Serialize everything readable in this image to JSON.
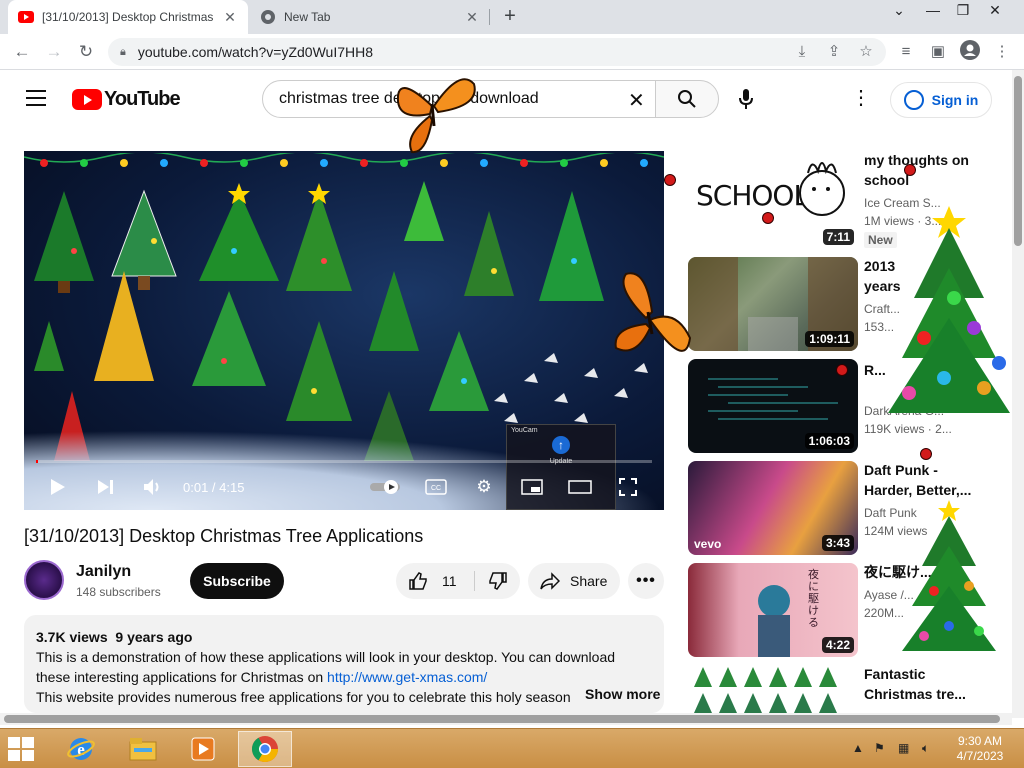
{
  "browser": {
    "tabs": [
      {
        "title": "[31/10/2013] Desktop Christmas",
        "active": true
      },
      {
        "title": "New Tab",
        "active": false
      }
    ],
    "url": "youtube.com/watch?v=yZd0WuI7HH8"
  },
  "header": {
    "logo_text": "YouTube",
    "search_value": "christmas tree desktop toy download",
    "signin_label": "Sign in"
  },
  "player": {
    "time_text": "0:01 / 4:15",
    "progress_fraction": 0.004,
    "popup_title": "YouCam",
    "popup_text": "Update"
  },
  "video": {
    "title": "[31/10/2013] Desktop Christmas Tree Applications",
    "channel": "Janilyn",
    "subscribers": "148 subscribers",
    "subscribe_label": "Subscribe",
    "likes": "11",
    "share_label": "Share",
    "more_label": "•••"
  },
  "description": {
    "views": "3.7K views",
    "age": "9 years ago",
    "line1": "This is a demonstration of how these applications will look in your desktop. You can download",
    "line2_prefix": "these interesting applications for Christmas on",
    "link": "http://www.get-xmas.com/",
    "line3": "This website provides numerous free applications for you to celebrate this holy season",
    "show_more": "Show more"
  },
  "recommendations": [
    {
      "title_l1": "my thoughts on",
      "title_l2": "school",
      "channel": "Ice Cream S...",
      "views": "1M views · 3...",
      "badge": "New",
      "duration": "7:11",
      "thumb_text": "SCHOOL"
    },
    {
      "title_l1": "2013",
      "title_l2": "years",
      "channel": "Craft...",
      "views": "153...",
      "duration": "1:09:11"
    },
    {
      "title_l1": "R...",
      "title_l2": "",
      "channel": "DarkArena G...",
      "views": "119K views · 2...",
      "duration": "1:06:03"
    },
    {
      "title_l1": "Daft Punk -",
      "title_l2": "Harder, Better,...",
      "channel": "Daft Punk",
      "views": "124M views",
      "duration": "3:43",
      "thumb_text": "vevo"
    },
    {
      "title_l1": "夜に駆け...",
      "title_l2": "",
      "channel": "Ayase /...",
      "views": "220M...",
      "duration": "4:22",
      "thumb_text": "夜に駆ける"
    },
    {
      "title_l1": "Fantastic",
      "title_l2": "Christmas tre..."
    }
  ],
  "taskbar": {
    "time": "9:30 AM",
    "date": "4/7/2023"
  },
  "colors": {
    "youtube_red": "#ff0000",
    "link_blue": "#065fd4",
    "taskbar": "#c98f45"
  }
}
